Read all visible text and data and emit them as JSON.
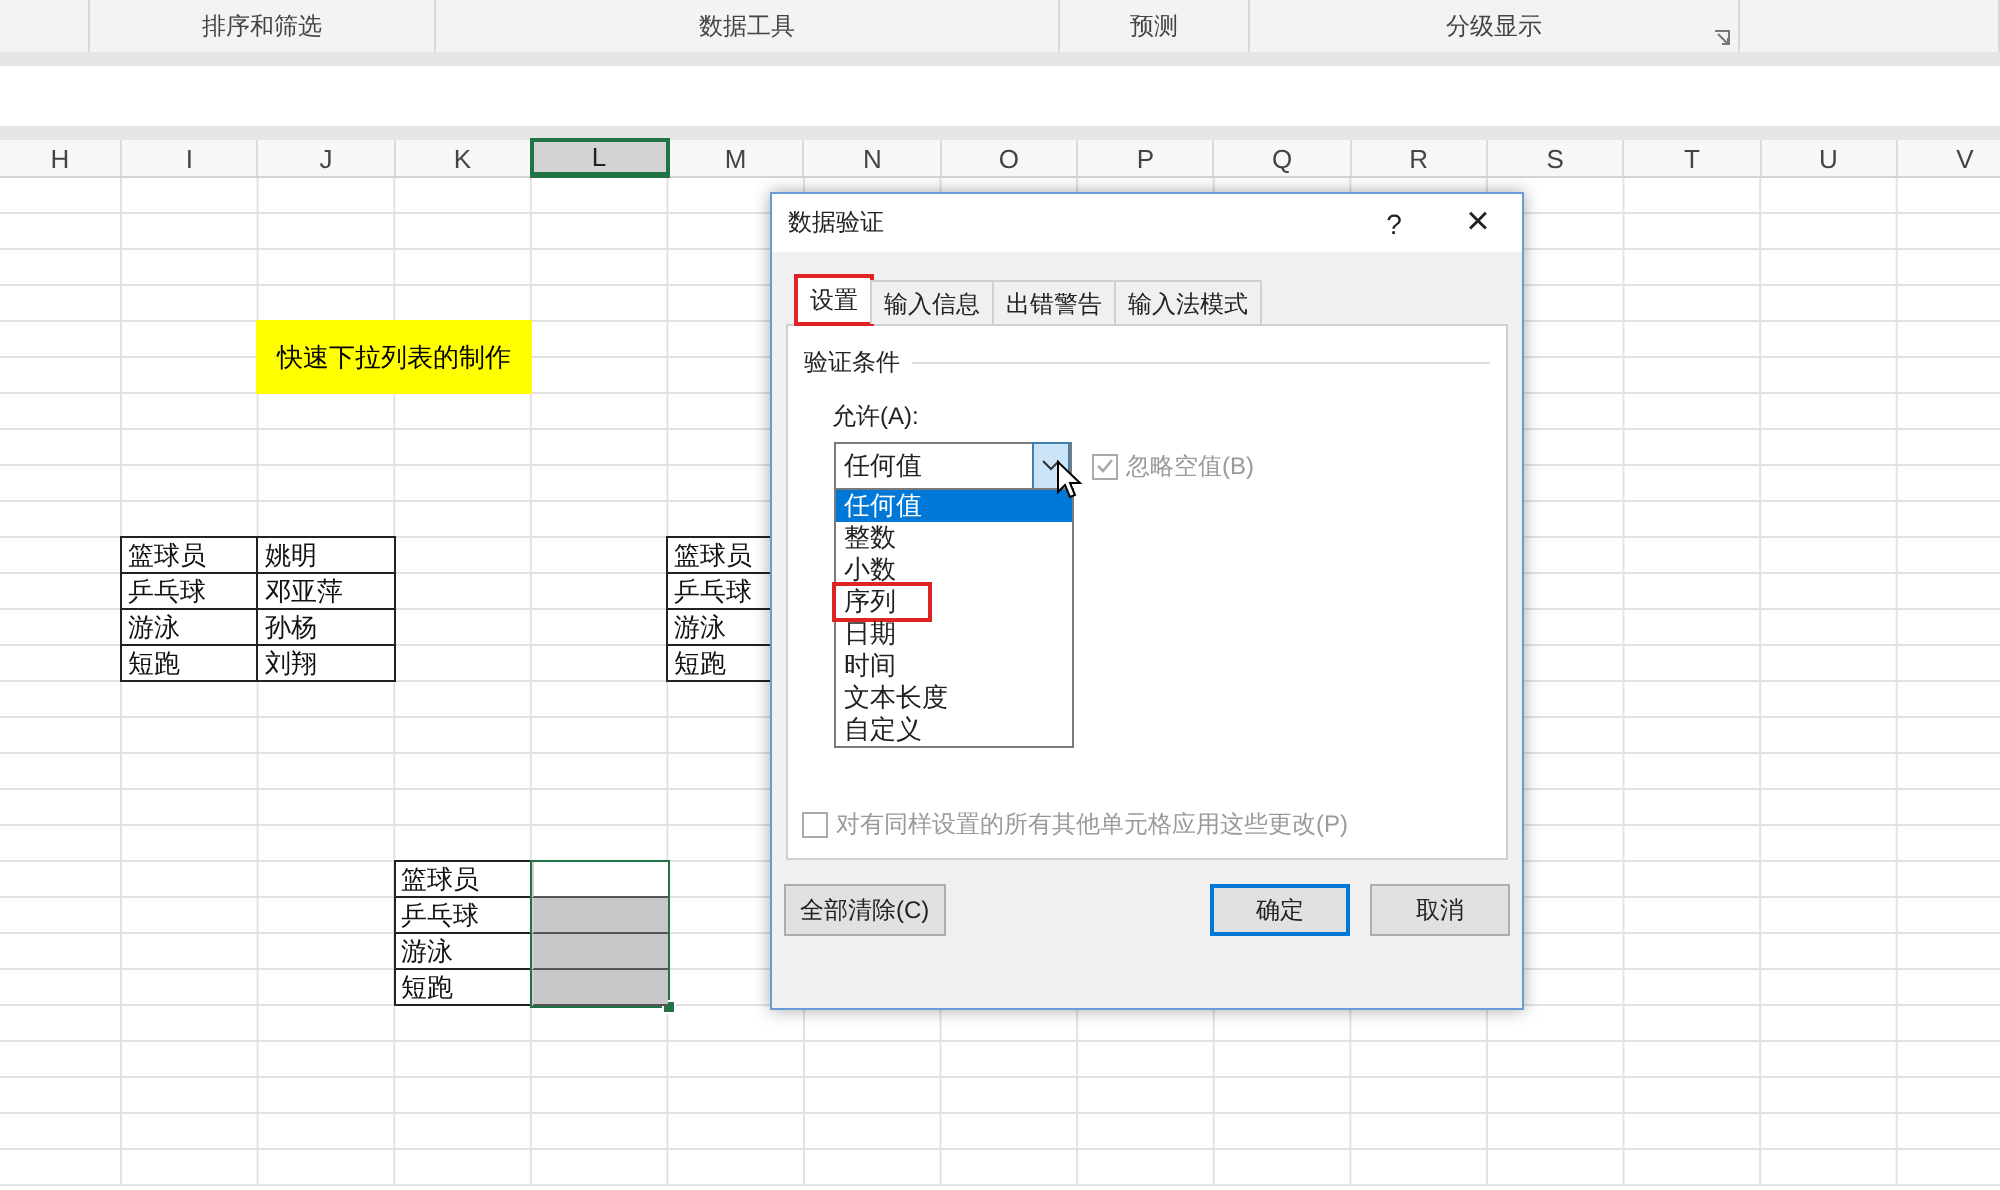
{
  "ribbon": {
    "groups": [
      {
        "label": "排序和筛选",
        "launcher": false
      },
      {
        "label": "数据工具",
        "launcher": false
      },
      {
        "label": "预测",
        "launcher": false
      },
      {
        "label": "分级显示",
        "launcher": true
      }
    ]
  },
  "sheet": {
    "columns": [
      {
        "label": "H",
        "selected": false
      },
      {
        "label": "I",
        "selected": false
      },
      {
        "label": "J",
        "selected": false
      },
      {
        "label": "K",
        "selected": false
      },
      {
        "label": "L",
        "selected": true
      },
      {
        "label": "M",
        "selected": false
      },
      {
        "label": "N",
        "selected": false
      },
      {
        "label": "O",
        "selected": false
      },
      {
        "label": "P",
        "selected": false
      },
      {
        "label": "Q",
        "selected": false
      },
      {
        "label": "R",
        "selected": false
      },
      {
        "label": "S",
        "selected": false
      },
      {
        "label": "T",
        "selected": false
      },
      {
        "label": "U",
        "selected": false
      },
      {
        "label": "V",
        "selected": false
      }
    ],
    "title_cell": {
      "text": "快速下拉列表的制作",
      "color": "#ffff00"
    },
    "tables": [
      {
        "rows": [
          [
            "篮球员",
            "姚明"
          ],
          [
            "乒乓球",
            "邓亚萍"
          ],
          [
            "游泳",
            "孙杨"
          ],
          [
            "短跑",
            "刘翔"
          ]
        ]
      },
      {
        "rows": [
          [
            "篮球员"
          ],
          [
            "乒乓球"
          ],
          [
            "游泳"
          ],
          [
            "短跑"
          ]
        ]
      },
      {
        "rows": [
          [
            "篮球员"
          ],
          [
            "乒乓球"
          ],
          [
            "游泳"
          ],
          [
            "短跑"
          ]
        ],
        "input_cells": [
          {
            "shaded": false
          },
          {
            "shaded": true
          },
          {
            "shaded": true
          },
          {
            "shaded": true
          }
        ],
        "input_selected": true
      }
    ]
  },
  "dialog": {
    "title": "数据验证",
    "help": "?",
    "close": "×",
    "tabs": [
      {
        "label": "设置",
        "selected": true,
        "highlighted": true
      },
      {
        "label": "输入信息",
        "selected": false,
        "highlighted": false
      },
      {
        "label": "出错警告",
        "selected": false,
        "highlighted": false
      },
      {
        "label": "输入法模式",
        "selected": false,
        "highlighted": false
      }
    ],
    "section": "验证条件",
    "allow_label": "允许(A):",
    "allow_value": "任何值",
    "dropdown_open": true,
    "ignore_blank": {
      "label": "忽略空值(B)",
      "checked": true,
      "disabled": true
    },
    "options": [
      {
        "label": "任何值",
        "selected": true,
        "highlighted": false
      },
      {
        "label": "整数",
        "selected": false,
        "highlighted": false
      },
      {
        "label": "小数",
        "selected": false,
        "highlighted": false
      },
      {
        "label": "序列",
        "selected": false,
        "highlighted": true
      },
      {
        "label": "日期",
        "selected": false,
        "highlighted": false
      },
      {
        "label": "时间",
        "selected": false,
        "highlighted": false
      },
      {
        "label": "文本长度",
        "selected": false,
        "highlighted": false
      },
      {
        "label": "自定义",
        "selected": false,
        "highlighted": false
      }
    ],
    "apply_all": {
      "label": "对有同样设置的所有其他单元格应用这些更改(P)",
      "checked": false,
      "disabled": true
    },
    "buttons": [
      {
        "label": "全部清除(C)",
        "default": false
      },
      {
        "label": "确定",
        "default": true
      },
      {
        "label": "取消",
        "default": false
      }
    ]
  }
}
